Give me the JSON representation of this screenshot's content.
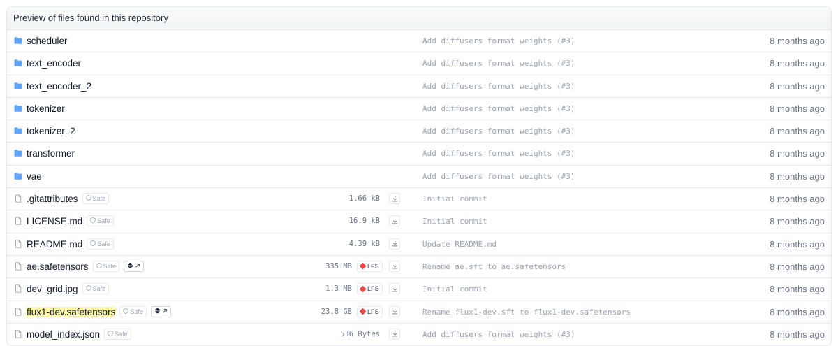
{
  "header": {
    "title": "Preview of files found in this repository"
  },
  "colors": {
    "folder": "#60a5fa",
    "lfs": "#ef4444",
    "highlight": "#fdf6a5"
  },
  "rows": [
    {
      "type": "folder",
      "name": "scheduler",
      "commit": "Add diffusers format weights (#3)",
      "date": "8 months ago"
    },
    {
      "type": "folder",
      "name": "text_encoder",
      "commit": "Add diffusers format weights (#3)",
      "date": "8 months ago"
    },
    {
      "type": "folder",
      "name": "text_encoder_2",
      "commit": "Add diffusers format weights (#3)",
      "date": "8 months ago"
    },
    {
      "type": "folder",
      "name": "tokenizer",
      "commit": "Add diffusers format weights (#3)",
      "date": "8 months ago"
    },
    {
      "type": "folder",
      "name": "tokenizer_2",
      "commit": "Add diffusers format weights (#3)",
      "date": "8 months ago"
    },
    {
      "type": "folder",
      "name": "transformer",
      "commit": "Add diffusers format weights (#3)",
      "date": "8 months ago"
    },
    {
      "type": "folder",
      "name": "vae",
      "commit": "Add diffusers format weights (#3)",
      "date": "8 months ago"
    },
    {
      "type": "file",
      "name": ".gitattributes",
      "safe": "Safe",
      "size": "1.66 kB",
      "commit": "Initial commit",
      "date": "8 months ago"
    },
    {
      "type": "file",
      "name": "LICENSE.md",
      "safe": "Safe",
      "size": "16.9 kB",
      "commit": "Initial commit",
      "date": "8 months ago"
    },
    {
      "type": "file",
      "name": "README.md",
      "safe": "Safe",
      "size": "4.39 kB",
      "commit": "Update README.md",
      "date": "8 months ago"
    },
    {
      "type": "file",
      "name": "ae.safetensors",
      "safe": "Safe",
      "viewer": true,
      "size": "335 MB",
      "lfs": "LFS",
      "commit": "Rename ae.sft to ae.safetensors",
      "date": "8 months ago"
    },
    {
      "type": "file",
      "name": "dev_grid.jpg",
      "safe": "Safe",
      "size": "1.3 MB",
      "lfs": "LFS",
      "commit": "Initial commit",
      "date": "8 months ago"
    },
    {
      "type": "file",
      "name": "flux1-dev.safetensors",
      "highlight": true,
      "safe": "Safe",
      "viewer": true,
      "size": "23.8 GB",
      "lfs": "LFS",
      "commit": "Rename flux1-dev.sft to flux1-dev.safetensors",
      "date": "8 months ago"
    },
    {
      "type": "file",
      "name": "model_index.json",
      "safe": "Safe",
      "size": "536 Bytes",
      "commit": "Add diffusers format weights (#3)",
      "date": "8 months ago"
    }
  ]
}
